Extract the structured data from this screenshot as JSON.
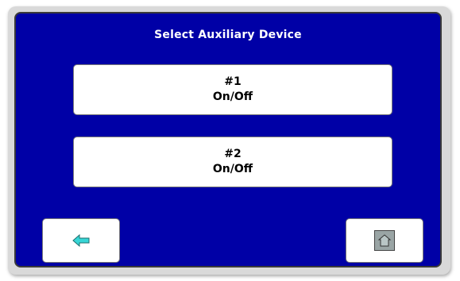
{
  "screen": {
    "title": "Select Auxiliary Device",
    "background_color": "#0000a6"
  },
  "devices": [
    {
      "number": "#1",
      "action": "On/Off"
    },
    {
      "number": "#2",
      "action": "On/Off"
    }
  ],
  "navigation": {
    "back_icon": "left-arrow-icon",
    "back_icon_color": "#37d6d6",
    "home_icon": "home-icon"
  }
}
